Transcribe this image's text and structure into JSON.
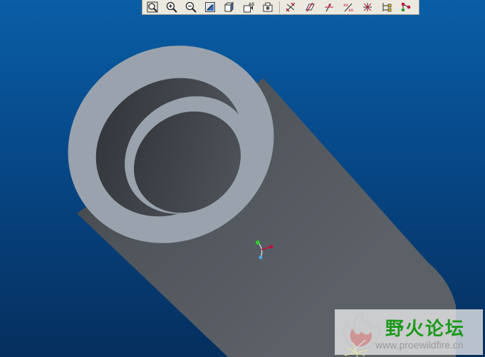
{
  "toolbar": {
    "items": [
      {
        "name": "refit-icon"
      },
      {
        "name": "zoom-in-icon"
      },
      {
        "name": "zoom-out-icon"
      },
      {
        "name": "repaint-icon"
      },
      {
        "name": "view-orientation-icon"
      },
      {
        "name": "saved-views-icon"
      },
      {
        "name": "layers-icon"
      },
      {
        "name": "datum-planes-icon"
      },
      {
        "name": "datum-axes-icon"
      },
      {
        "name": "datum-points-icon"
      },
      {
        "name": "coordinate-systems-icon"
      },
      {
        "name": "spin-center-icon"
      },
      {
        "name": "model-tree-icon"
      },
      {
        "name": "network-icon"
      }
    ]
  },
  "viewport": {
    "background_top": "#0a5ea6",
    "background_bottom": "#052f5e",
    "model_color": "#5a5f66",
    "face_color": "#9aa3ad"
  },
  "triad": {
    "x_color": "#c0103a",
    "y_color": "#2ecc2e",
    "z_color": "#4aa8e8"
  },
  "watermark": {
    "title": "野火论坛",
    "url": "www.proewildfire.cn",
    "title_color": "#1c9a1c"
  }
}
